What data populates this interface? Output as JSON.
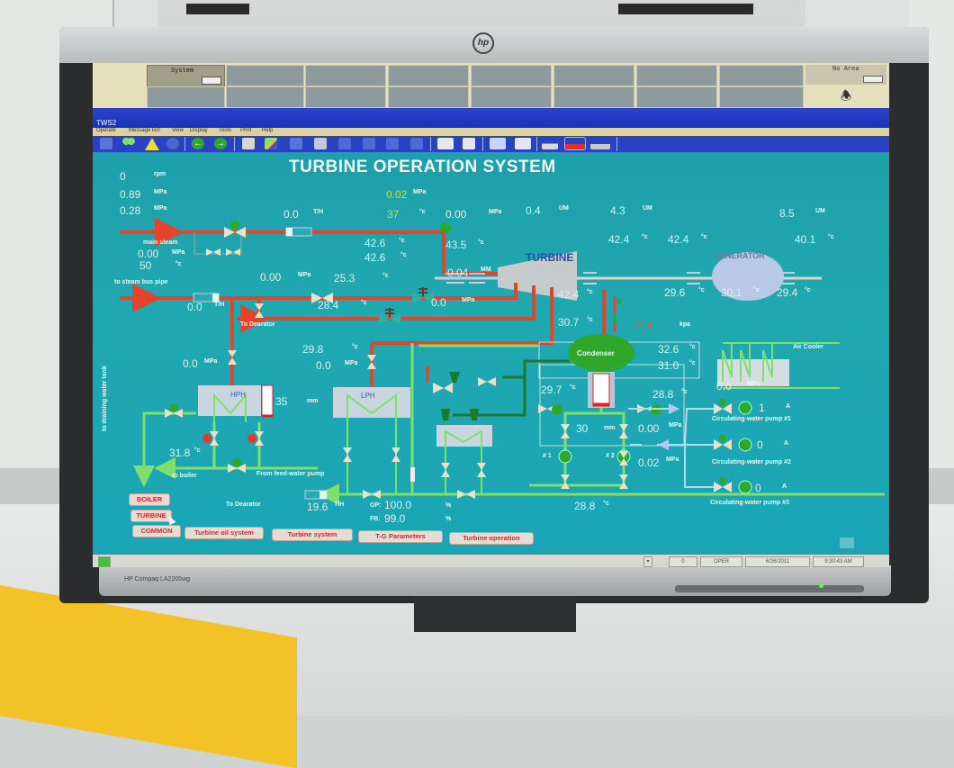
{
  "window": {
    "title": "TWS2",
    "system_label": "System",
    "area_label": "No Area"
  },
  "menu": [
    "Operate",
    "Message list!",
    "View",
    "Display",
    "Tools",
    "Print",
    "Help"
  ],
  "toolbar_icons": [
    "overview-icon",
    "network-icon",
    "alarm-warning-icon",
    "info-icon",
    "back-arrow-icon",
    "forward-arrow-icon",
    "report-icon",
    "graphic-icon",
    "grid-icon",
    "trend-icon",
    "chart-icon",
    "tuning-icon",
    "cycle-icon",
    "group-icon",
    "keyboard-icon",
    "calc-icon",
    "windows-stack-icon",
    "tile-icon",
    "alarm-doc-icon",
    "alarm-red-icon",
    "alarm-gray-icon"
  ],
  "diagram": {
    "title": "TURBINE OPERATION SYSTEM",
    "speed": {
      "value": "0",
      "unit": "rpm"
    },
    "pressure_1": {
      "value": "0.89",
      "unit": "MPa"
    },
    "pressure_2": {
      "value": "0.28",
      "unit": "MPa"
    },
    "top_pressure": {
      "value": "0.02",
      "unit": "MPa"
    },
    "top_temp": {
      "value": "37",
      "unit": "°c"
    },
    "main_steam_flow": {
      "value": "0.0",
      "unit": "T/H"
    },
    "header_pressure": {
      "value": "0.00",
      "unit": "MPa"
    },
    "vibration_1": {
      "value": "0.4",
      "unit": "UM"
    },
    "vibration_2": {
      "value": "4.3",
      "unit": "UM"
    },
    "vibration_3": {
      "value": "8.5",
      "unit": "UM"
    },
    "main_steam": {
      "label": "main steam",
      "pressure": "0.00",
      "pressure_unit": "MPa",
      "temp": "50",
      "temp_unit": "°c"
    },
    "temp_a": {
      "value": "42.6",
      "unit": "°c"
    },
    "temp_b": {
      "value": "42.6",
      "unit": "°c"
    },
    "temp_c": {
      "value": "43.5",
      "unit": "°c"
    },
    "axial_disp": {
      "value": "-0.04",
      "unit": "MM"
    },
    "turbine_label": "TURBINE",
    "bearing_1": {
      "value": "42.4",
      "unit": "°c"
    },
    "bearing_2": {
      "value": "42.4",
      "unit": "°c"
    },
    "bearing_3": {
      "value": "40.1",
      "unit": "°c"
    },
    "generator_label": "GENERATOR",
    "gen_temp_1": {
      "value": "29.6",
      "unit": "°c"
    },
    "gen_temp_2": {
      "value": "30.1",
      "unit": "°c"
    },
    "gen_temp_3": {
      "value": "29.4",
      "unit": "°c"
    },
    "exhaust_temp": {
      "value": "42.4",
      "unit": "°c"
    },
    "steam_bus": {
      "label": "to steam bus pipe",
      "flow": "0.0",
      "flow_unit": "T/H"
    },
    "ext_pressure": {
      "value": "0.00",
      "unit": "MPa"
    },
    "ext_temp": {
      "value": "25.3",
      "unit": "°c"
    },
    "ext_temp_2": {
      "value": "28.4",
      "unit": "°c"
    },
    "ext_pressure_2": {
      "value": "0.0",
      "unit": "MPa"
    },
    "ext_temp_unit_only": "°c",
    "to_dearator_1": "To Dearator",
    "hph_pressure": {
      "value": "0.0",
      "unit": "MPa"
    },
    "lph_temp": {
      "value": "29.8",
      "unit": "°c"
    },
    "lph_pressure": {
      "value": "0.0",
      "unit": "MPa"
    },
    "hph": {
      "label": "HPH",
      "level": "35",
      "level_unit": "mm"
    },
    "lph": {
      "label": "LPH"
    },
    "condenser_in_temp": {
      "value": "30.7",
      "unit": "°c"
    },
    "vacuum": {
      "value": "-0.4",
      "unit": "kpa"
    },
    "condenser_label": "Condenser",
    "cw_out_temp_1": {
      "value": "32.6",
      "unit": "°c"
    },
    "cw_out_temp_2": {
      "value": "31.0",
      "unit": "°c"
    },
    "air_cooler_label": "Air Cooler",
    "hotwell_temp": {
      "value": "29.7",
      "unit": "°c"
    },
    "cw_in_temp": {
      "value": "28.8",
      "unit": "°c"
    },
    "cw_header_pressure": {
      "value": "0.0",
      "unit": "MPa"
    },
    "hotwell_level": {
      "value": "30",
      "unit": "mm"
    },
    "cond_pump_pressure": {
      "value": "0.00",
      "unit": "MPa"
    },
    "cond_pump_pressure_2": {
      "value": "0.02",
      "unit": "MPa"
    },
    "cond_pump_1": "# 1",
    "cond_pump_2": "# 2",
    "condensate_temp": {
      "value": "28.8",
      "unit": "°c"
    },
    "drain_label": "to draining water tank",
    "boiler_feed_temp": {
      "value": "31.8",
      "unit": "°c"
    },
    "to_boiler": "to boiler",
    "from_feed_pump": "From feed-water pump",
    "to_dearator_2": "To Dearator",
    "condensate_flow": {
      "value": "19.6",
      "unit": "T/H"
    },
    "valve_op": {
      "label": "OP:",
      "value": "100.0",
      "unit": "%"
    },
    "valve_fb": {
      "label": "FB:",
      "value": "99.0",
      "unit": "%"
    },
    "cw_pumps": [
      {
        "label": "Circulating-water pump #1",
        "current": "1",
        "unit": "A"
      },
      {
        "label": "Circulating-water pump #2",
        "current": "0",
        "unit": "A"
      },
      {
        "label": "Circulating-water pump #3",
        "current": "0",
        "unit": "A"
      }
    ]
  },
  "nav": {
    "side": [
      "BOILER",
      "TURBINE",
      "COMMON"
    ],
    "tabs": [
      "Turbine oil system",
      "Turbine system",
      "T-G Parameters",
      "Turbine operation"
    ]
  },
  "status": {
    "alarm_count": "0",
    "mode": "OPER",
    "date": "6/26/2011",
    "time": "9:30:43 AM"
  },
  "monitor": {
    "model": "HP Compaq LA2205wg",
    "brand": "hp"
  },
  "colors": {
    "steam_pipe": "#e2442e",
    "water_pipe": "#7ee06a",
    "screen_bg": "#1fa4ad",
    "toolbar": "#2843c2",
    "nav_text": "#d8262a"
  }
}
